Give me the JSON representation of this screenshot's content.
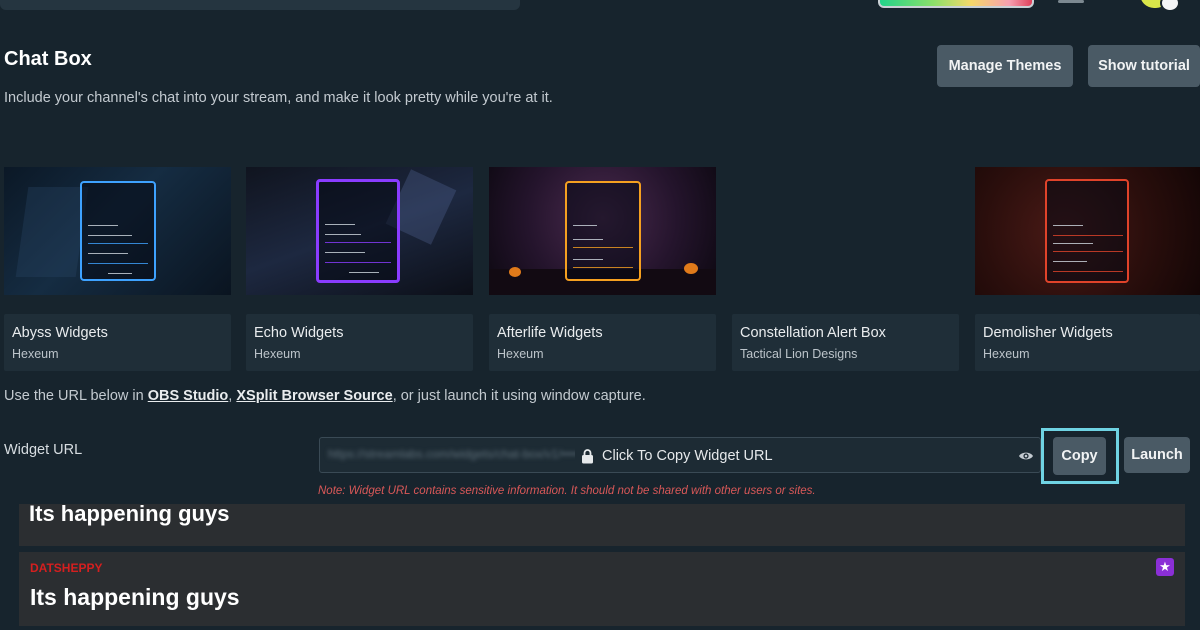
{
  "header": {
    "title": "Chat Box",
    "description": "Include your channel's chat into your stream, and make it look pretty while you're at it.",
    "manage_themes_label": "Manage Themes",
    "show_tutorial_label": "Show tutorial"
  },
  "themes": [
    {
      "name": "Abyss Widgets",
      "author": "Hexeum",
      "accent": "#3ea2ff"
    },
    {
      "name": "Echo Widgets",
      "author": "Hexeum",
      "accent": "#8a3cff"
    },
    {
      "name": "Afterlife Widgets",
      "author": "Hexeum",
      "accent": "#f5a020"
    },
    {
      "name": "Constellation Alert Box",
      "author": "Tactical Lion Designs",
      "accent": "#17242d"
    },
    {
      "name": "Demolisher Widgets",
      "author": "Hexeum",
      "accent": "#e0432a"
    }
  ],
  "url_help": {
    "prefix": "Use the URL below in ",
    "obs_link": "OBS Studio",
    "comma": ", ",
    "xsplit_link": "XSplit Browser Source",
    "suffix": ", or just launch it using window capture."
  },
  "widget_url": {
    "label": "Widget URL",
    "blurred_value": "https://streamlabs.com/widgets/chat-box/v1/••••••••••••••••••••",
    "center_text": "Click To Copy Widget URL",
    "copy_label": "Copy",
    "launch_label": "Launch",
    "note": "Note: Widget URL contains sensitive information. It should not be shared with other users or sites."
  },
  "chat_preview": [
    {
      "text": "Its happening guys"
    },
    {
      "user": "DATSHEPPY",
      "text": "Its happening guys",
      "user_color": "#d51f1f"
    }
  ],
  "icons": {
    "lock": "lock-icon",
    "eye": "eye-icon",
    "badge": "star-badge-icon"
  }
}
